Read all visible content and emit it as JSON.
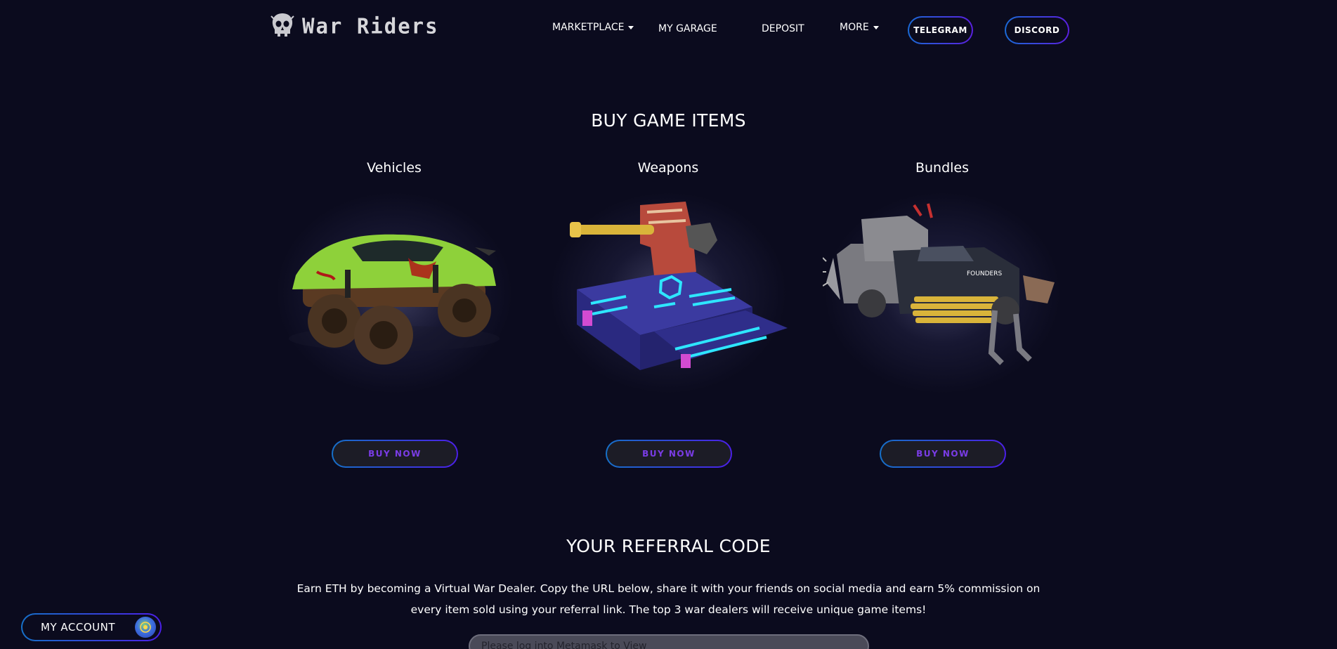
{
  "header": {
    "brand": "War Riders",
    "nav": {
      "marketplace": "MARKETPLACE",
      "my_garage": "MY GARAGE",
      "deposit": "DEPOSIT",
      "more": "MORE"
    },
    "telegram": "TELEGRAM",
    "discord": "DISCORD"
  },
  "buy_section": {
    "title": "BUY GAME ITEMS",
    "items": [
      {
        "title": "Vehicles",
        "button": "BUY NOW"
      },
      {
        "title": "Weapons",
        "button": "BUY NOW"
      },
      {
        "title": "Bundles",
        "button": "BUY NOW"
      }
    ]
  },
  "referral": {
    "title": "YOUR REFERRAL CODE",
    "description": "Earn ETH by becoming a Virtual War Dealer. Copy the URL below, share it with your friends on social media and earn 5% commission on every item sold using your referral link. The top 3 war dealers will receive unique game items!",
    "placeholder": "Please log into Metamask to View"
  },
  "account": {
    "label": "MY ACCOUNT"
  }
}
